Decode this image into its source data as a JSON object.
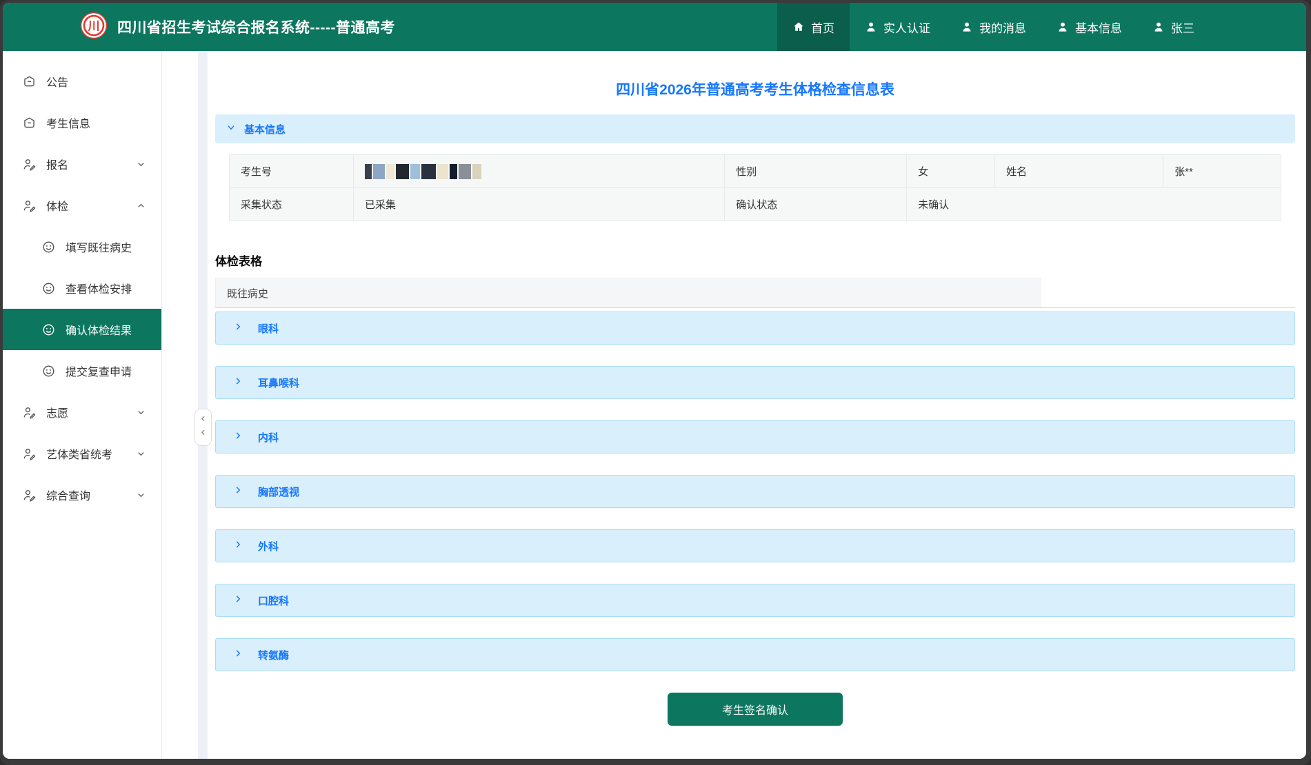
{
  "header": {
    "title": "四川省招生考试综合报名系统-----普通高考",
    "logo": "sichuan-admissions-seal-logo",
    "colors": {
      "bg": "#0d765f",
      "active_bg": "#0a5e4b"
    },
    "nav": [
      {
        "id": "home",
        "label": "首页",
        "icon": "home-icon",
        "active": true
      },
      {
        "id": "real-auth",
        "label": "实人认证",
        "icon": "user-icon",
        "active": false
      },
      {
        "id": "messages",
        "label": "我的消息",
        "icon": "user-icon",
        "active": false
      },
      {
        "id": "basicinfo",
        "label": "基本信息",
        "icon": "user-icon",
        "active": false
      },
      {
        "id": "user",
        "label": "张三",
        "icon": "user-icon",
        "active": false
      }
    ]
  },
  "sidebar": {
    "active_color": "#0d765f",
    "items": [
      {
        "id": "announcements",
        "label": "公告",
        "icon": "badge-icon",
        "level": 1
      },
      {
        "id": "candidate-info",
        "label": "考生信息",
        "icon": "badge-icon",
        "level": 1
      },
      {
        "id": "registration",
        "label": "报名",
        "icon": "user-edit-icon",
        "level": 1,
        "chevron": "down"
      },
      {
        "id": "physical-exam",
        "label": "体检",
        "icon": "user-edit-icon",
        "level": 1,
        "chevron": "up"
      },
      {
        "id": "fill-history",
        "label": "填写既往病史",
        "icon": "smiley-icon",
        "level": 2
      },
      {
        "id": "view-schedule",
        "label": "查看体检安排",
        "icon": "smiley-icon",
        "level": 2
      },
      {
        "id": "confirm-result",
        "label": "确认体检结果",
        "icon": "smiley-icon",
        "level": 2,
        "active": true
      },
      {
        "id": "review-request",
        "label": "提交复查申请",
        "icon": "smiley-icon",
        "level": 2
      },
      {
        "id": "preferences",
        "label": "志愿",
        "icon": "user-edit-icon",
        "level": 1,
        "chevron": "down"
      },
      {
        "id": "arts-sports",
        "label": "艺体类省统考",
        "icon": "user-edit-icon",
        "level": 1,
        "chevron": "down"
      },
      {
        "id": "general-query",
        "label": "综合查询",
        "icon": "user-edit-icon",
        "level": 1,
        "chevron": "down"
      }
    ]
  },
  "collapse_handle": {
    "icon": "chevron-left-icon",
    "count": 2
  },
  "main": {
    "page_title": "四川省2026年普通高考考生体格检查信息表",
    "basic_info": {
      "section_title": "基本信息",
      "chevron_icon": "chevron-down-icon",
      "fields": {
        "candidate_no": {
          "label": "考生号",
          "value": "",
          "redacted": true
        },
        "gender": {
          "label": "性别",
          "value": "女"
        },
        "name": {
          "label": "姓名",
          "value": "张**"
        },
        "collection_status": {
          "label": "采集状态",
          "value": "已采集"
        },
        "confirm_status": {
          "label": "确认状态",
          "value": "未确认"
        }
      },
      "redaction_blocks": [
        "#3a3f4d",
        "#8ca6c4",
        "#f0e8d2",
        "#22262f",
        "#9fc0dd",
        "#2a3040",
        "#ece4cc",
        "#141b2b",
        "#8a8f99",
        "#d9d2bd"
      ]
    },
    "exam_form": {
      "heading": "体检表格",
      "history_label": "既往病史",
      "section_chevron_icon": "chevron-right-icon",
      "sections": [
        {
          "id": "ophthalmology",
          "label": "眼科"
        },
        {
          "id": "ent",
          "label": "耳鼻喉科"
        },
        {
          "id": "internal-med",
          "label": "内科"
        },
        {
          "id": "chest-xray",
          "label": "胸部透视"
        },
        {
          "id": "surgery",
          "label": "外科"
        },
        {
          "id": "dental",
          "label": "口腔科"
        },
        {
          "id": "transaminase",
          "label": "转氨酶"
        }
      ]
    },
    "confirm_button_label": "考生签名确认"
  }
}
